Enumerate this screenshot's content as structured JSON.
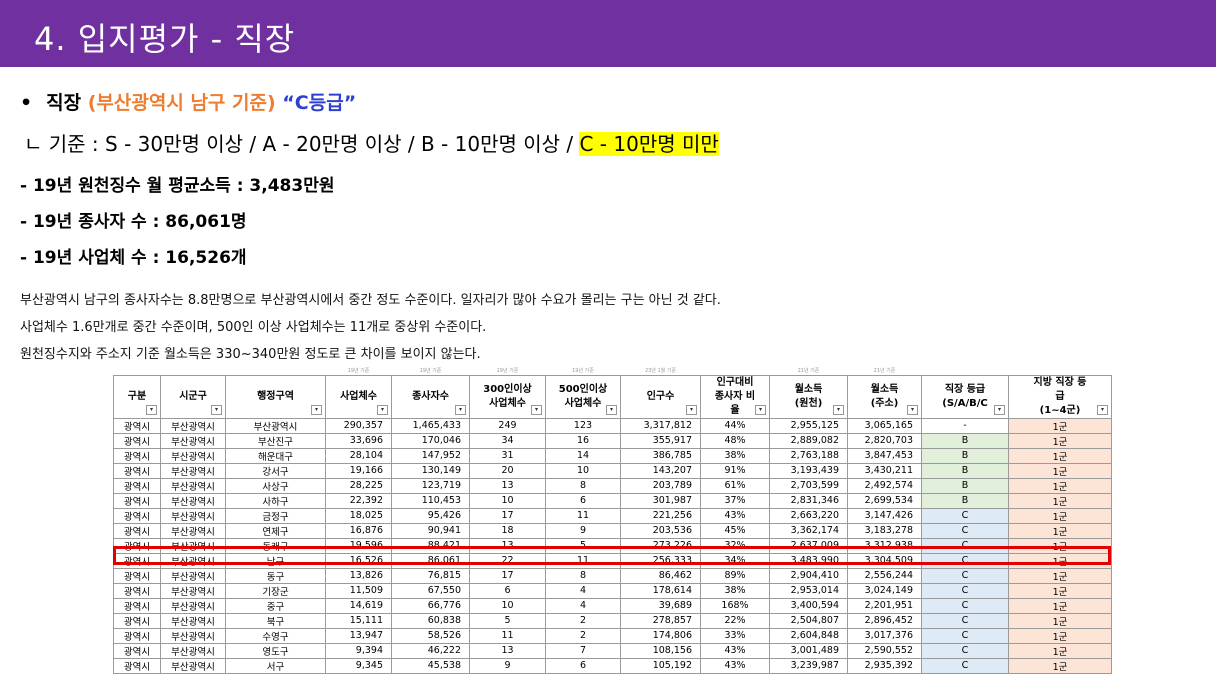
{
  "header": {
    "title": "4. 입지평가 - 직장"
  },
  "bullet": {
    "dot": "•",
    "label": "직장",
    "scope": "(부산광역시 남구 기준)",
    "grade": "“C등급”"
  },
  "criteria": {
    "prefix": "ㄴ 기준 : S - 30만명 이상 / A - 20만명 이상 / B - 10만명 이상 /",
    "highlight": "C - 10만명 미만"
  },
  "stats": [
    "- 19년 원천징수 월 평균소득 : 3,483만원",
    "- 19년 종사자 수 : 86,061명",
    "- 19년 사업체 수 : 16,526개"
  ],
  "description": [
    "부산광역시 남구의 종사자수는 8.8만명으로 부산광역시에서 중간 정도 수준이다. 일자리가 많아 수요가 몰리는 구는 아닌 것 같다.",
    "사업체수 1.6만개로 중간 수준이며, 500인 이상 사업체수는 11개로 중상위 수준이다.",
    "원천징수지와 주소지 기준 월소득은 330~340만원 정도로 큰 차이를 보이지 않는다."
  ],
  "table": {
    "source_notes": [
      "",
      "",
      "",
      "19년 기준",
      "19년 기준",
      "19년 기준",
      "19년 기준",
      "23년 1월 기준",
      "",
      "21년 기준",
      "21년 기준",
      "",
      ""
    ],
    "headers": [
      "구분",
      "시군구",
      "행정구역",
      "사업체수",
      "종사자수",
      "300인이상\n사업체수",
      "500인이상\n사업체수",
      "인구수",
      "인구대비\n종사자 비\n율",
      "월소득\n(원천)",
      "월소득\n(주소)",
      "직장 등급\n(S/A/B/C",
      "지방 직장 등\n급\n(1~4군)"
    ],
    "highlight_row": 9,
    "rows": [
      [
        "광역시",
        "부산광역시",
        "부산광역시",
        "290,357",
        "1,465,433",
        "249",
        "123",
        "3,317,812",
        "44%",
        "2,955,125",
        "3,065,165",
        "-",
        "1군"
      ],
      [
        "광역시",
        "부산광역시",
        "부산진구",
        "33,696",
        "170,046",
        "34",
        "16",
        "355,917",
        "48%",
        "2,889,082",
        "2,820,703",
        "B",
        "1군"
      ],
      [
        "광역시",
        "부산광역시",
        "해운대구",
        "28,104",
        "147,952",
        "31",
        "14",
        "386,785",
        "38%",
        "2,763,188",
        "3,847,453",
        "B",
        "1군"
      ],
      [
        "광역시",
        "부산광역시",
        "강서구",
        "19,166",
        "130,149",
        "20",
        "10",
        "143,207",
        "91%",
        "3,193,439",
        "3,430,211",
        "B",
        "1군"
      ],
      [
        "광역시",
        "부산광역시",
        "사상구",
        "28,225",
        "123,719",
        "13",
        "8",
        "203,789",
        "61%",
        "2,703,599",
        "2,492,574",
        "B",
        "1군"
      ],
      [
        "광역시",
        "부산광역시",
        "사하구",
        "22,392",
        "110,453",
        "10",
        "6",
        "301,987",
        "37%",
        "2,831,346",
        "2,699,534",
        "B",
        "1군"
      ],
      [
        "광역시",
        "부산광역시",
        "금정구",
        "18,025",
        "95,426",
        "17",
        "11",
        "221,256",
        "43%",
        "2,663,220",
        "3,147,426",
        "C",
        "1군"
      ],
      [
        "광역시",
        "부산광역시",
        "연제구",
        "16,876",
        "90,941",
        "18",
        "9",
        "203,536",
        "45%",
        "3,362,174",
        "3,183,278",
        "C",
        "1군"
      ],
      [
        "광역시",
        "부산광역시",
        "동래구",
        "19,596",
        "88,421",
        "13",
        "5",
        "273,226",
        "32%",
        "2,637,009",
        "3,312,938",
        "C",
        "1군"
      ],
      [
        "광역시",
        "부산광역시",
        "남구",
        "16,526",
        "86,061",
        "22",
        "11",
        "256,333",
        "34%",
        "3,483,990",
        "3,304,509",
        "C",
        "1군"
      ],
      [
        "광역시",
        "부산광역시",
        "동구",
        "13,826",
        "76,815",
        "17",
        "8",
        "86,462",
        "89%",
        "2,904,410",
        "2,556,244",
        "C",
        "1군"
      ],
      [
        "광역시",
        "부산광역시",
        "기장군",
        "11,509",
        "67,550",
        "6",
        "4",
        "178,614",
        "38%",
        "2,953,014",
        "3,024,149",
        "C",
        "1군"
      ],
      [
        "광역시",
        "부산광역시",
        "중구",
        "14,619",
        "66,776",
        "10",
        "4",
        "39,689",
        "168%",
        "3,400,594",
        "2,201,951",
        "C",
        "1군"
      ],
      [
        "광역시",
        "부산광역시",
        "북구",
        "15,111",
        "60,838",
        "5",
        "2",
        "278,857",
        "22%",
        "2,504,807",
        "2,896,452",
        "C",
        "1군"
      ],
      [
        "광역시",
        "부산광역시",
        "수영구",
        "13,947",
        "58,526",
        "11",
        "2",
        "174,806",
        "33%",
        "2,604,848",
        "3,017,376",
        "C",
        "1군"
      ],
      [
        "광역시",
        "부산광역시",
        "영도구",
        "9,394",
        "46,222",
        "13",
        "7",
        "108,156",
        "43%",
        "3,001,489",
        "2,590,552",
        "C",
        "1군"
      ],
      [
        "광역시",
        "부산광역시",
        "서구",
        "9,345",
        "45,538",
        "9",
        "6",
        "105,192",
        "43%",
        "3,239,987",
        "2,935,392",
        "C",
        "1군"
      ]
    ]
  }
}
